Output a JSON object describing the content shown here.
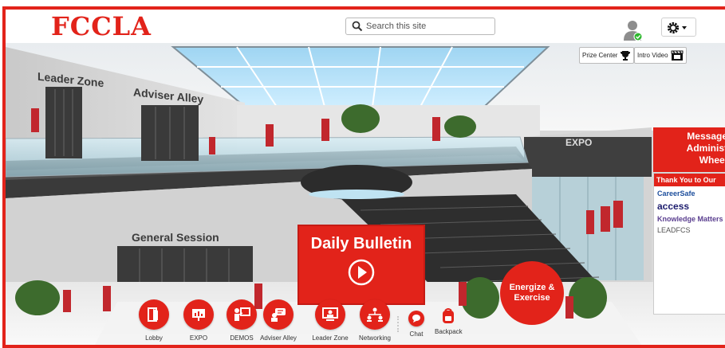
{
  "header": {
    "logo": "FCCLA",
    "search_placeholder": "Search this site"
  },
  "toplinks": {
    "prize": "Prize Center",
    "intro": "Intro Video"
  },
  "walls": {
    "leader_zone": "Leader Zone",
    "adviser_alley": "Adviser Alley",
    "general_session": "General Session",
    "expo": "EXPO"
  },
  "message_board": [
    "Message",
    "Administ",
    "Wheel"
  ],
  "sponsors": {
    "heading": "Thank You to Our",
    "items": [
      "CareerSafe",
      "access",
      "Knowledge Matters",
      "LEADFCS"
    ]
  },
  "bulletin": {
    "title": "Daily Bulletin"
  },
  "energize": {
    "line1": "Energize &",
    "line2": "Exercise"
  },
  "nav": {
    "lobby": "Lobby",
    "expo": "EXPO",
    "demos": "DEMOS",
    "adviser_alley": "Adviser Alley",
    "leader_zone": "Leader Zone",
    "networking": "Networking",
    "chat": "Chat",
    "backpack": "Backpack"
  },
  "colors": {
    "brand_red": "#e2231a",
    "online_green": "#2eb82e"
  }
}
